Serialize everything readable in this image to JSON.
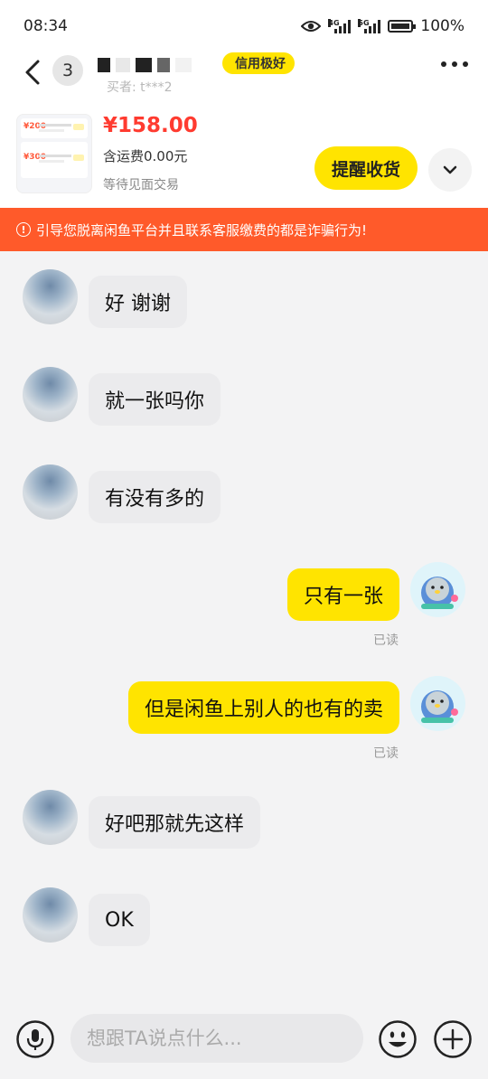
{
  "status_bar": {
    "time": "08:34",
    "signal1_tag": "4G",
    "signal2_tag": "5G",
    "battery": "100%"
  },
  "header": {
    "unread_count": "3",
    "credit_badge": "信用极好",
    "seller_sub": "买者: t***2"
  },
  "order": {
    "price": "¥158.00",
    "shipping": "含运费0.00元",
    "status": "等待见面交易",
    "remind_label": "提醒收货",
    "thumb_amounts": [
      "¥200",
      "¥300"
    ]
  },
  "warning": {
    "text": "引导您脱离闲鱼平台并且联系客服缴费的都是诈骗行为!"
  },
  "messages": [
    {
      "side": "left",
      "text": "好 谢谢"
    },
    {
      "side": "left",
      "text": "就一张吗你"
    },
    {
      "side": "left",
      "text": "有没有多的"
    },
    {
      "side": "right",
      "text": "只有一张",
      "read": "已读"
    },
    {
      "side": "right",
      "text": "但是闲鱼上别人的也有的卖",
      "read": "已读"
    },
    {
      "side": "left",
      "text": "好吧那就先这样"
    },
    {
      "side": "left",
      "text": "OK"
    }
  ],
  "input": {
    "placeholder": "想跟TA说点什么..."
  },
  "colors": {
    "accent_yellow": "#ffe400",
    "warning_orange": "#ff5a2a",
    "price_red": "#ff3b30"
  }
}
